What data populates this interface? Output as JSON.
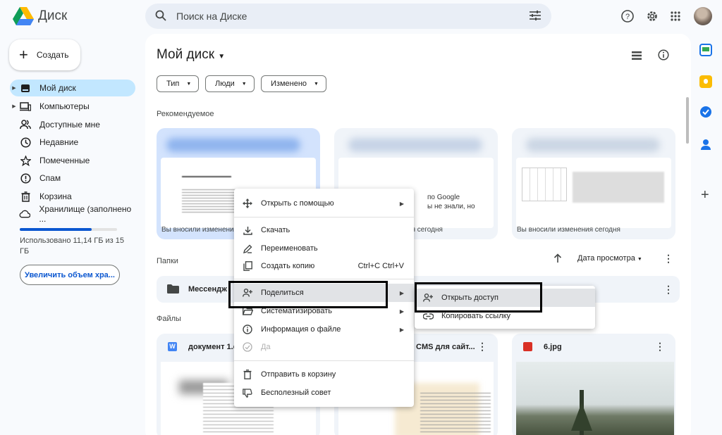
{
  "app": {
    "name": "Диск"
  },
  "search": {
    "placeholder": "Поиск на Диске"
  },
  "create": {
    "label": "Создать"
  },
  "nav": {
    "items": [
      {
        "label": "Мой диск",
        "icon": "my-drive-icon"
      },
      {
        "label": "Компьютеры",
        "icon": "computer-icon"
      },
      {
        "label": "Доступные мне",
        "icon": "shared-people-icon"
      },
      {
        "label": "Недавние",
        "icon": "clock-icon"
      },
      {
        "label": "Помеченные",
        "icon": "star-icon"
      },
      {
        "label": "Спам",
        "icon": "spam-icon"
      },
      {
        "label": "Корзина",
        "icon": "trash-icon"
      },
      {
        "label": "Хранилище (заполнено ...",
        "icon": "cloud-icon"
      }
    ]
  },
  "storage": {
    "text": "Использовано 11,14 ГБ из 15 ГБ",
    "used_fraction": 0.74,
    "upgrade_label": "Увеличить объем хра..."
  },
  "main": {
    "title": "Мой диск",
    "filters": [
      "Тип",
      "Люди",
      "Изменено"
    ],
    "recommended_label": "Рекомендуемое",
    "recommended_captions": [
      "Вы вносили изменения сегодня",
      "Вы вносили изменения сегодня",
      "Вы вносили изменения сегодня"
    ],
    "card2_text": [
      "по Google",
      "ы не знали, но"
    ],
    "folders_label": "Папки",
    "sort_label": "Дата просмотра",
    "folder_name": "Мессендж",
    "files_label": "Файлы",
    "files": [
      {
        "name": "документ 1.d"
      },
      {
        "name": "CMS для сайт..."
      },
      {
        "name": "6.jpg"
      }
    ]
  },
  "context_menu": {
    "items": [
      {
        "label": "Открыть с помощью",
        "icon": "open-with-icon",
        "submenu": true
      },
      {
        "label": "Скачать",
        "icon": "download-icon"
      },
      {
        "label": "Переименовать",
        "icon": "rename-icon"
      },
      {
        "label": "Создать копию",
        "icon": "copy-icon",
        "shortcut": "Ctrl+C Ctrl+V"
      },
      {
        "label": "Поделиться",
        "icon": "share-icon",
        "submenu": true
      },
      {
        "label": "Систематизировать",
        "icon": "organize-icon",
        "submenu": true
      },
      {
        "label": "Информация о файле",
        "icon": "info-icon",
        "submenu": true
      },
      {
        "label": "Да",
        "icon": "offline-icon",
        "disabled": true
      },
      {
        "label": "Отправить в корзину",
        "icon": "trash-icon"
      },
      {
        "label": "Бесполезный совет",
        "icon": "thumbs-down-icon"
      }
    ]
  },
  "share_submenu": {
    "items": [
      {
        "label": "Открыть доступ",
        "icon": "person-add-icon"
      },
      {
        "label": "Копировать ссылку",
        "icon": "link-icon"
      }
    ]
  },
  "colors": {
    "accent": "#0b57d0",
    "active_nav": "#c2e7ff",
    "highlight_box": "#000000"
  }
}
